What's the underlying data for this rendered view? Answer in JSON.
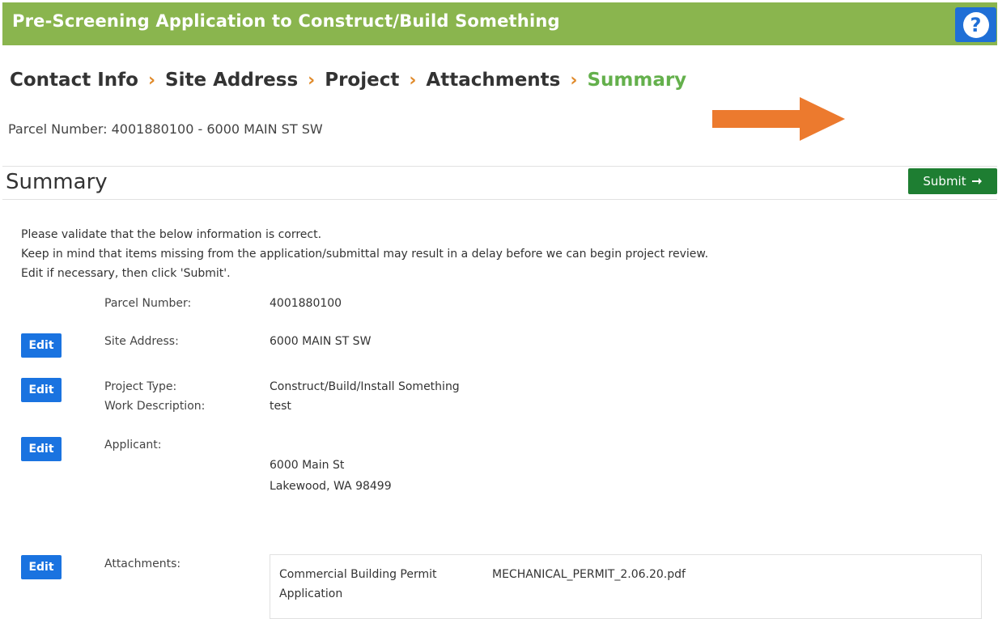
{
  "header": {
    "title": "Pre-Screening Application to Construct/Build Something",
    "help_symbol": "?"
  },
  "breadcrumb": {
    "items": [
      "Contact Info",
      "Site Address",
      "Project",
      "Attachments",
      "Summary"
    ],
    "separator": "›"
  },
  "parcel_line": "Parcel Number: 4001880100 - 6000 MAIN ST SW",
  "colors": {
    "header_bg": "#8ab54e",
    "help_bg": "#1f6fd6",
    "crumb_separator": "#e08a2a",
    "crumb_current": "#64b04c",
    "arrow": "#ec7a2e",
    "submit_bg": "#1e7e32",
    "edit_bg": "#1a73e0"
  },
  "summary": {
    "title": "Summary",
    "submit_label": "Submit",
    "submit_icon": "arrow-right-icon",
    "intro": [
      "Please validate that the below information is correct.",
      "Keep in mind that items missing from the application/submittal may result in a delay before we can begin project review.",
      "Edit if necessary, then click 'Submit'."
    ],
    "edit_label": "Edit",
    "parcel_label": "Parcel Number:",
    "parcel_value": "4001880100",
    "site_label": "Site Address:",
    "site_value": "6000 MAIN ST SW",
    "project_type_label": "Project Type:",
    "project_type_value": "Construct/Build/Install Something",
    "work_desc_label": "Work Description:",
    "work_desc_value": "test",
    "applicant_label": "Applicant:",
    "applicant_address_1": "6000 Main St",
    "applicant_address_2": "Lakewood, WA 98499",
    "attachments_label": "Attachments:",
    "attachment_type_1": "Commercial Building Permit",
    "attachment_type_2": "Application",
    "attachment_file": "MECHANICAL_PERMIT_2.06.20.pdf"
  }
}
